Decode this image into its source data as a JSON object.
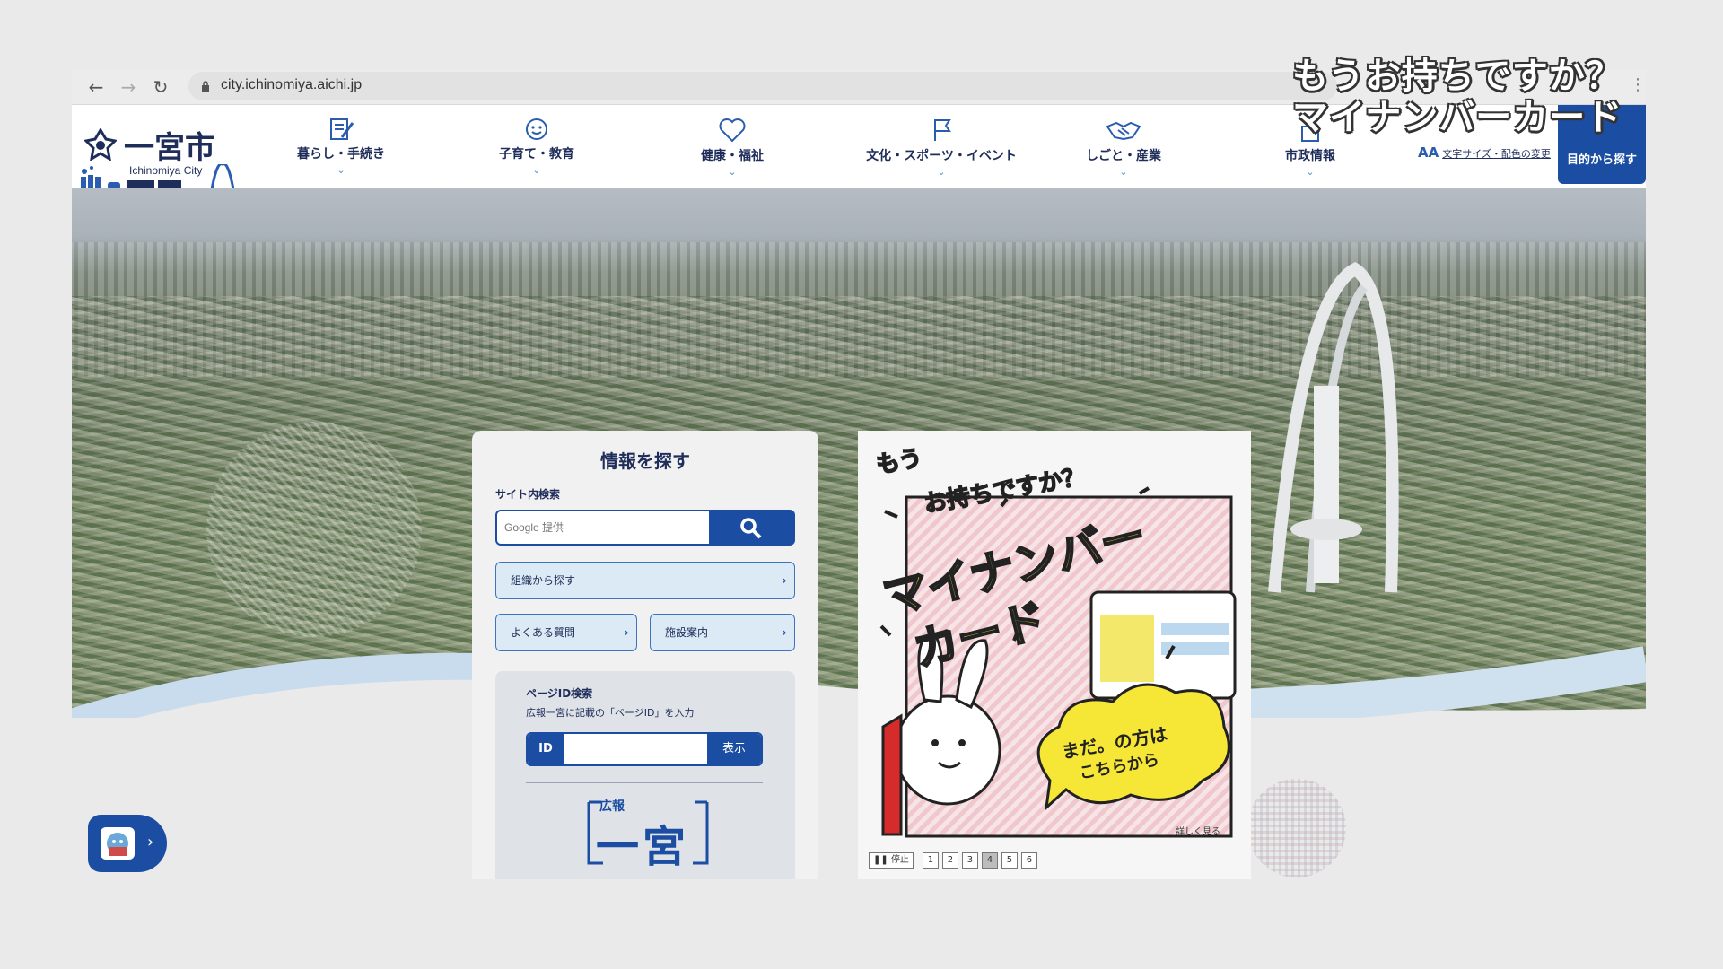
{
  "browser": {
    "url": "city.ichinomiya.aichi.jp",
    "icons": [
      "back-arrow-icon",
      "forward-arrow-icon",
      "reload-icon",
      "lock-icon",
      "menu-dots-icon"
    ]
  },
  "overlay_caption": {
    "line1": "もうお持ちですか？",
    "line2": "マイナンバーカード"
  },
  "site": {
    "logo_text": "一宮市",
    "logo_sub": "Ichinomiya City",
    "nav": [
      {
        "label": "暮らし・手続き",
        "icon": "document-pencil-icon"
      },
      {
        "label": "子育て・教育",
        "icon": "smiley-face-icon"
      },
      {
        "label": "健康・福祉",
        "icon": "heart-icon"
      },
      {
        "label": "文化・スポーツ・イベント",
        "icon": "flag-icon"
      },
      {
        "label": "しごと・産業",
        "icon": "handshake-icon"
      },
      {
        "label": "市政情報",
        "icon": "city-hall-icon"
      }
    ],
    "fontsize_link": "文字サイズ・配色の変更",
    "fontsize_icon": "AA",
    "purpose_button": "目的から探す"
  },
  "search_panel": {
    "title": "情報を探す",
    "site_search_label": "サイト内検索",
    "search_placeholder": "Google 提供",
    "org_search": "組織から探す",
    "faq": "よくある質問",
    "facility": "施設案内",
    "pageid_title": "ページID検索",
    "pageid_desc": "広報一宮に記載の「ページID」を入力",
    "pageid_label": "ID",
    "pageid_show": "表示",
    "koho_logo_small": "広報",
    "koho_logo_large": "一宮"
  },
  "banner": {
    "line1": "もう",
    "line2": "お持ちですか？",
    "line3": "マイナンバー",
    "line4": "カード",
    "bubble1": "まだ。の方は",
    "bubble2": "こちらから",
    "more": "詳しく見る",
    "pause": "停止",
    "pages": [
      "1",
      "2",
      "3",
      "4",
      "5",
      "6"
    ],
    "active_page": "4"
  },
  "colors": {
    "brand_blue": "#1b4ea2",
    "navy_text": "#1f2d5a",
    "banner_yellow": "#f6e636",
    "banner_pink": "#f3d3d8"
  }
}
